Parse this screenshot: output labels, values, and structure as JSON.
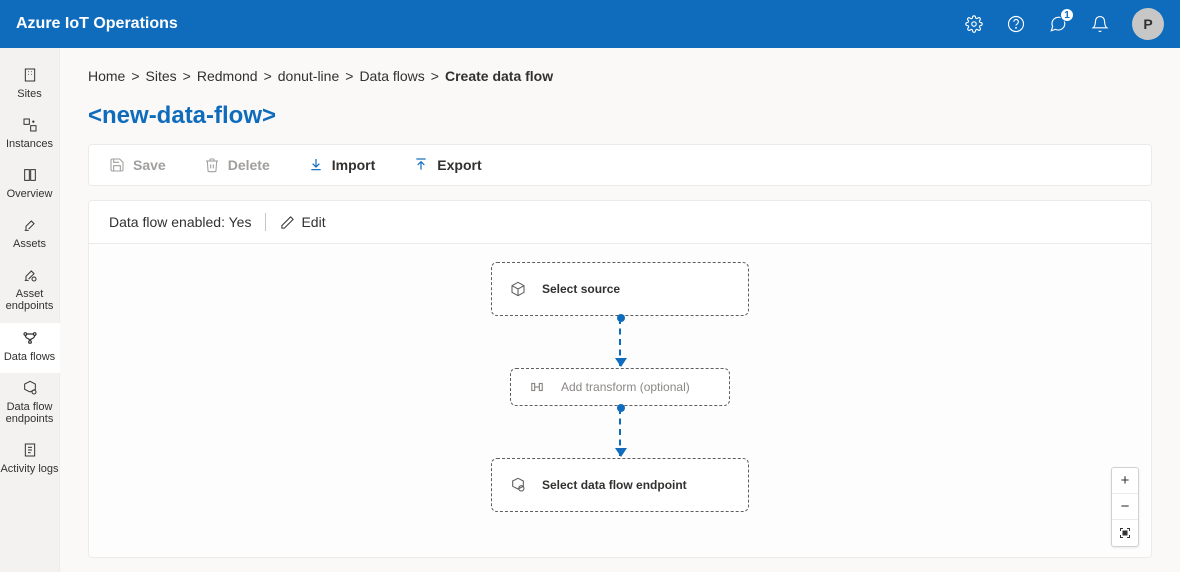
{
  "app": {
    "title": "Azure IoT Operations",
    "avatar_initial": "P"
  },
  "topbar": {
    "feedback_badge": "1"
  },
  "sidebar": {
    "items": [
      {
        "label": "Sites"
      },
      {
        "label": "Instances"
      },
      {
        "label": "Overview"
      },
      {
        "label": "Assets"
      },
      {
        "label": "Asset endpoints"
      },
      {
        "label": "Data flows",
        "active": true
      },
      {
        "label": "Data flow endpoints"
      },
      {
        "label": "Activity logs"
      }
    ]
  },
  "breadcrumb": {
    "items": [
      "Home",
      "Sites",
      "Redmond",
      "donut-line",
      "Data flows",
      "Create data flow"
    ]
  },
  "page": {
    "title": "<new-data-flow>"
  },
  "toolbar": {
    "save_label": "Save",
    "delete_label": "Delete",
    "import_label": "Import",
    "export_label": "Export"
  },
  "status": {
    "enabled_label": "Data flow enabled: Yes",
    "edit_label": "Edit"
  },
  "flow": {
    "source_label": "Select source",
    "transform_label": "Add transform (optional)",
    "endpoint_label": "Select data flow endpoint"
  },
  "zoom": {
    "in": "+",
    "out": "−"
  }
}
